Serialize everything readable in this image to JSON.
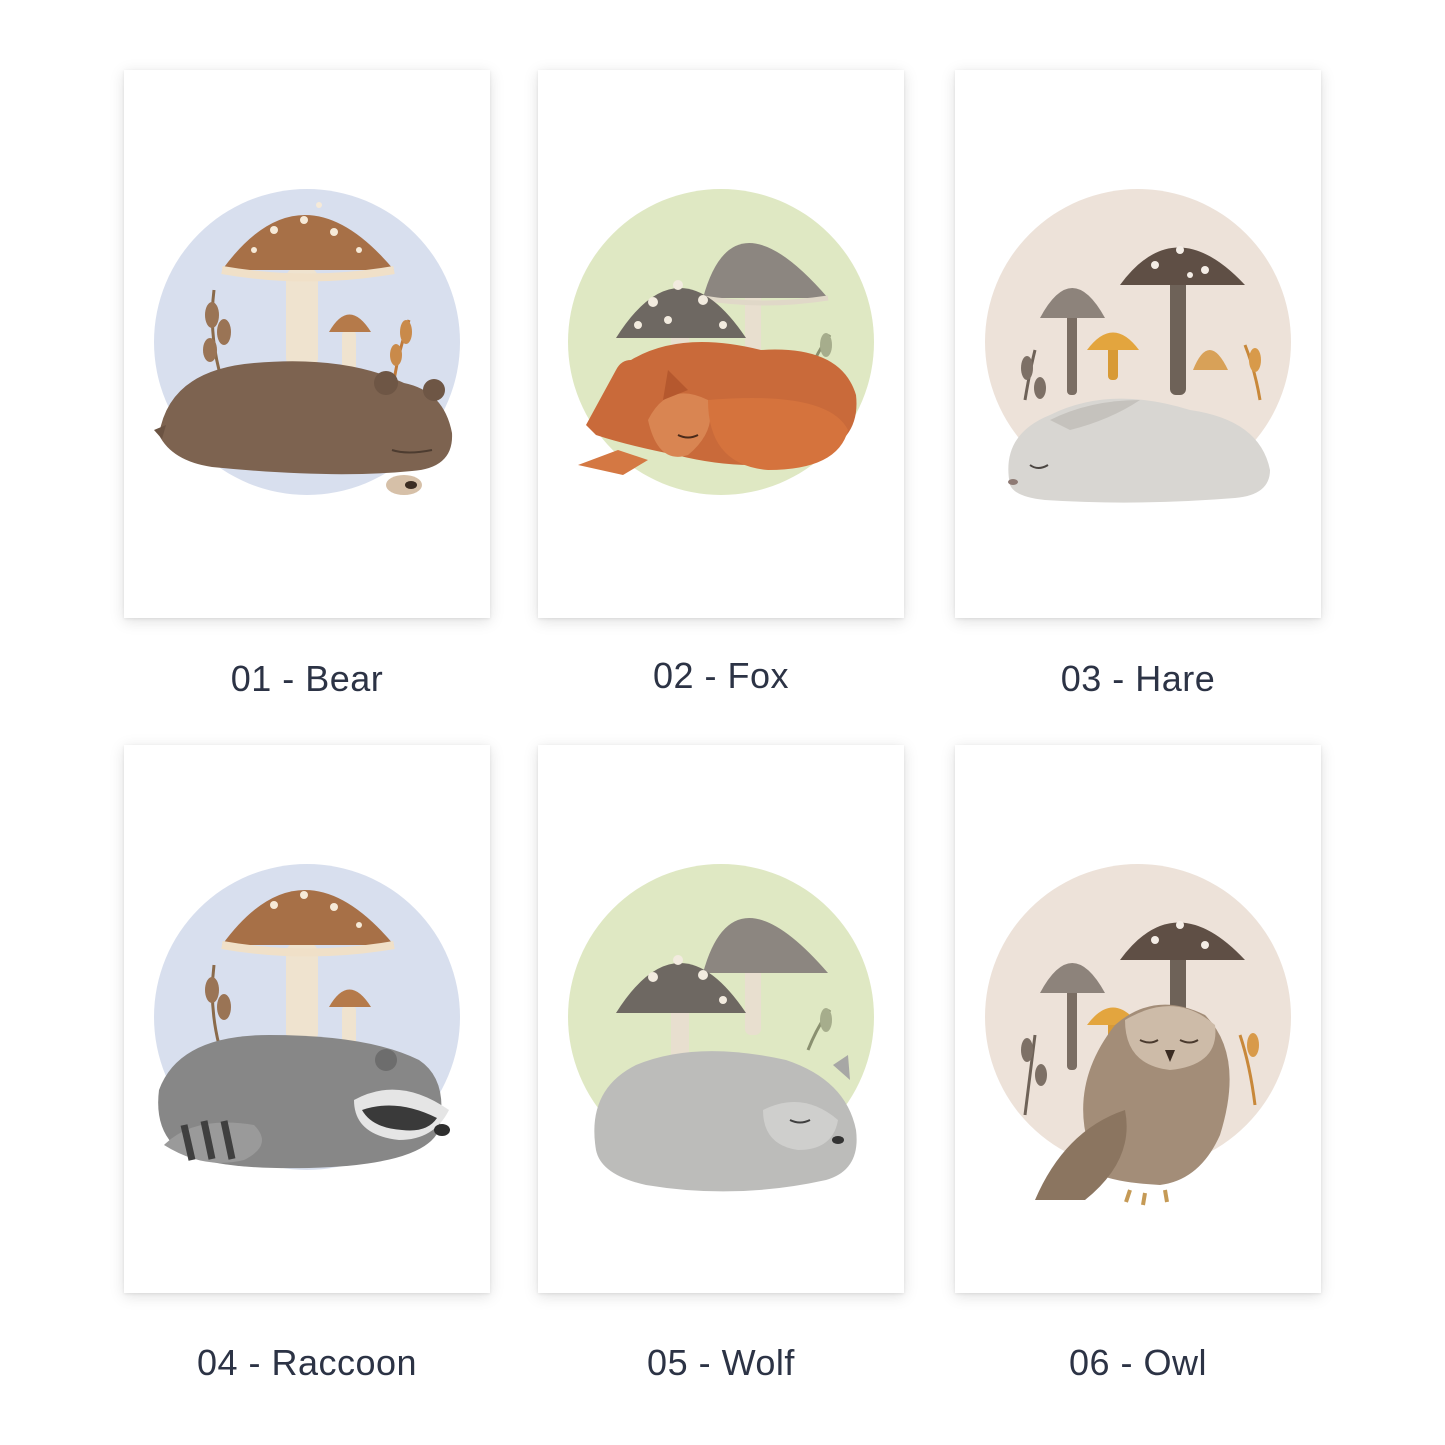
{
  "colors": {
    "blue_circle": "#d8dfee",
    "green_circle": "#dfe8c3",
    "beige_circle": "#ede2d9",
    "caption_text": "#2c3345"
  },
  "prints": [
    {
      "label": "01 - Bear",
      "animal_icon": "bear-illustration",
      "circle": "blue"
    },
    {
      "label": "02 - Fox",
      "animal_icon": "fox-illustration",
      "circle": "green"
    },
    {
      "label": "03 - Hare",
      "animal_icon": "hare-illustration",
      "circle": "beige"
    },
    {
      "label": "04 - Raccoon",
      "animal_icon": "raccoon-illustration",
      "circle": "blue"
    },
    {
      "label": "05 - Wolf",
      "animal_icon": "wolf-illustration",
      "circle": "green"
    },
    {
      "label": "06 - Owl",
      "animal_icon": "owl-illustration",
      "circle": "beige"
    }
  ]
}
